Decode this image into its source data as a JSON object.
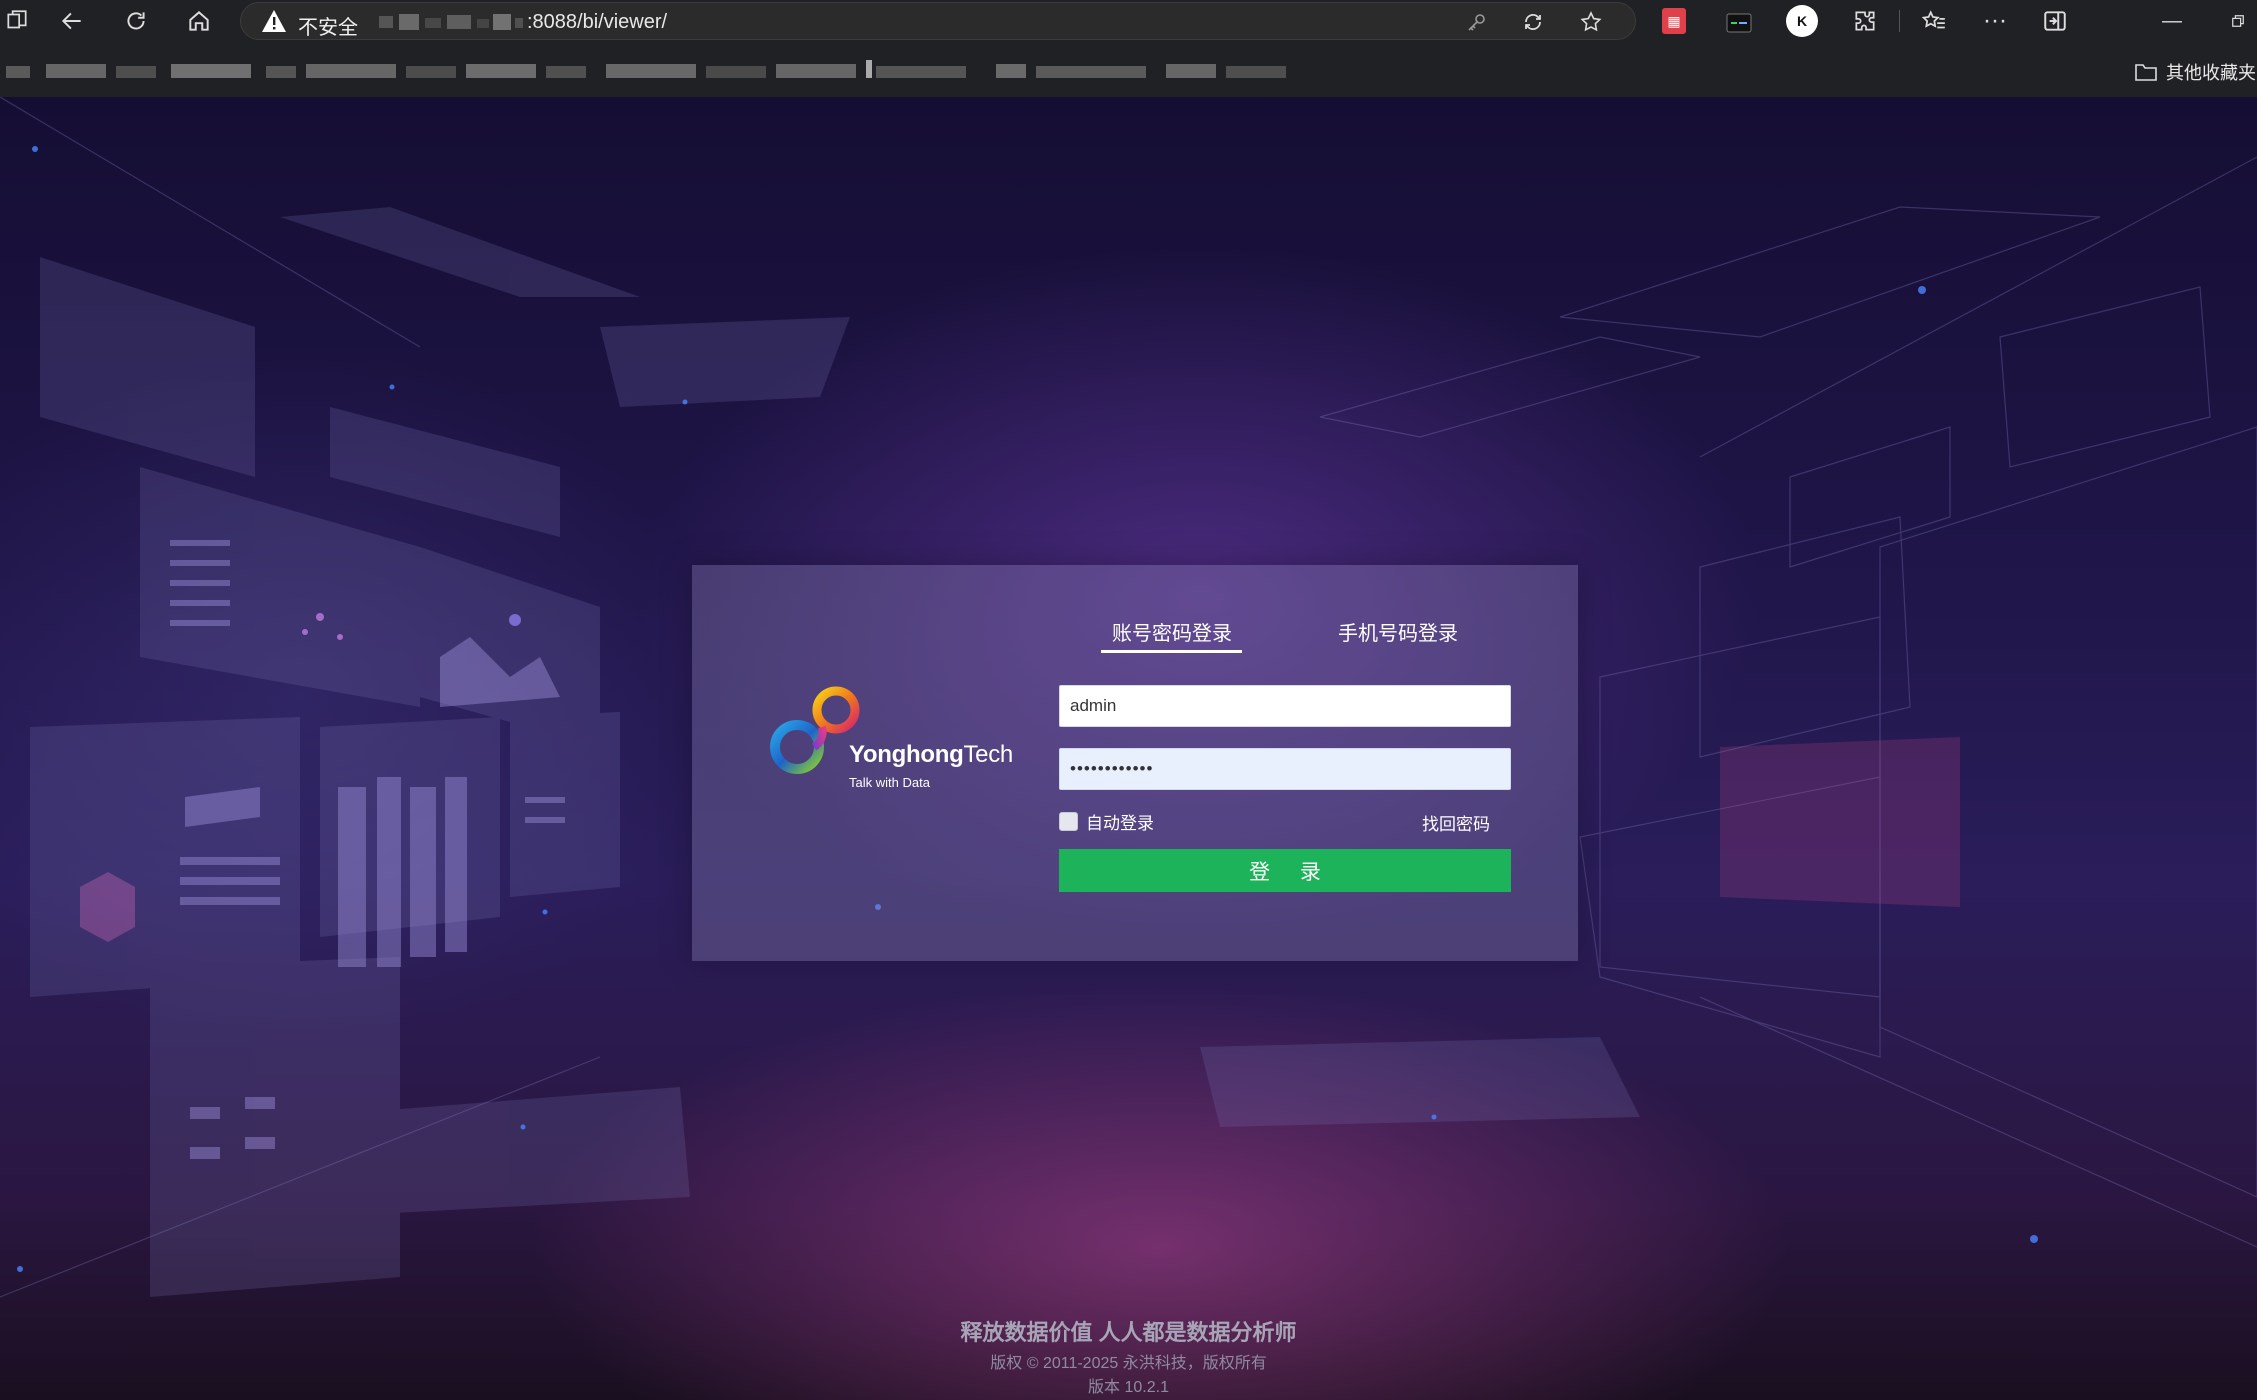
{
  "browser": {
    "insecure_label": "不安全",
    "url_visible": ":8088/bi/viewer/",
    "other_bookmarks": "其他收藏夹",
    "ext_k_label": "K"
  },
  "login": {
    "tab_account": "账号密码登录",
    "tab_phone": "手机号码登录",
    "username_value": "admin",
    "password_value": "••••••••••••",
    "auto_login_label": "自动登录",
    "forgot_label": "找回密码",
    "login_button": "登 录"
  },
  "brand": {
    "name_bold": "Yonghong",
    "name_light": "Tech",
    "tagline": "Talk with Data"
  },
  "footer": {
    "slogan": "释放数据价值 人人都是数据分析师",
    "copyright": "版权 © 2011-2025 永洪科技，版权所有",
    "version": "版本 10.2.1"
  },
  "colors": {
    "login_button": "#1db35a",
    "chrome_bg": "#202124",
    "warning": "#ffffff"
  }
}
